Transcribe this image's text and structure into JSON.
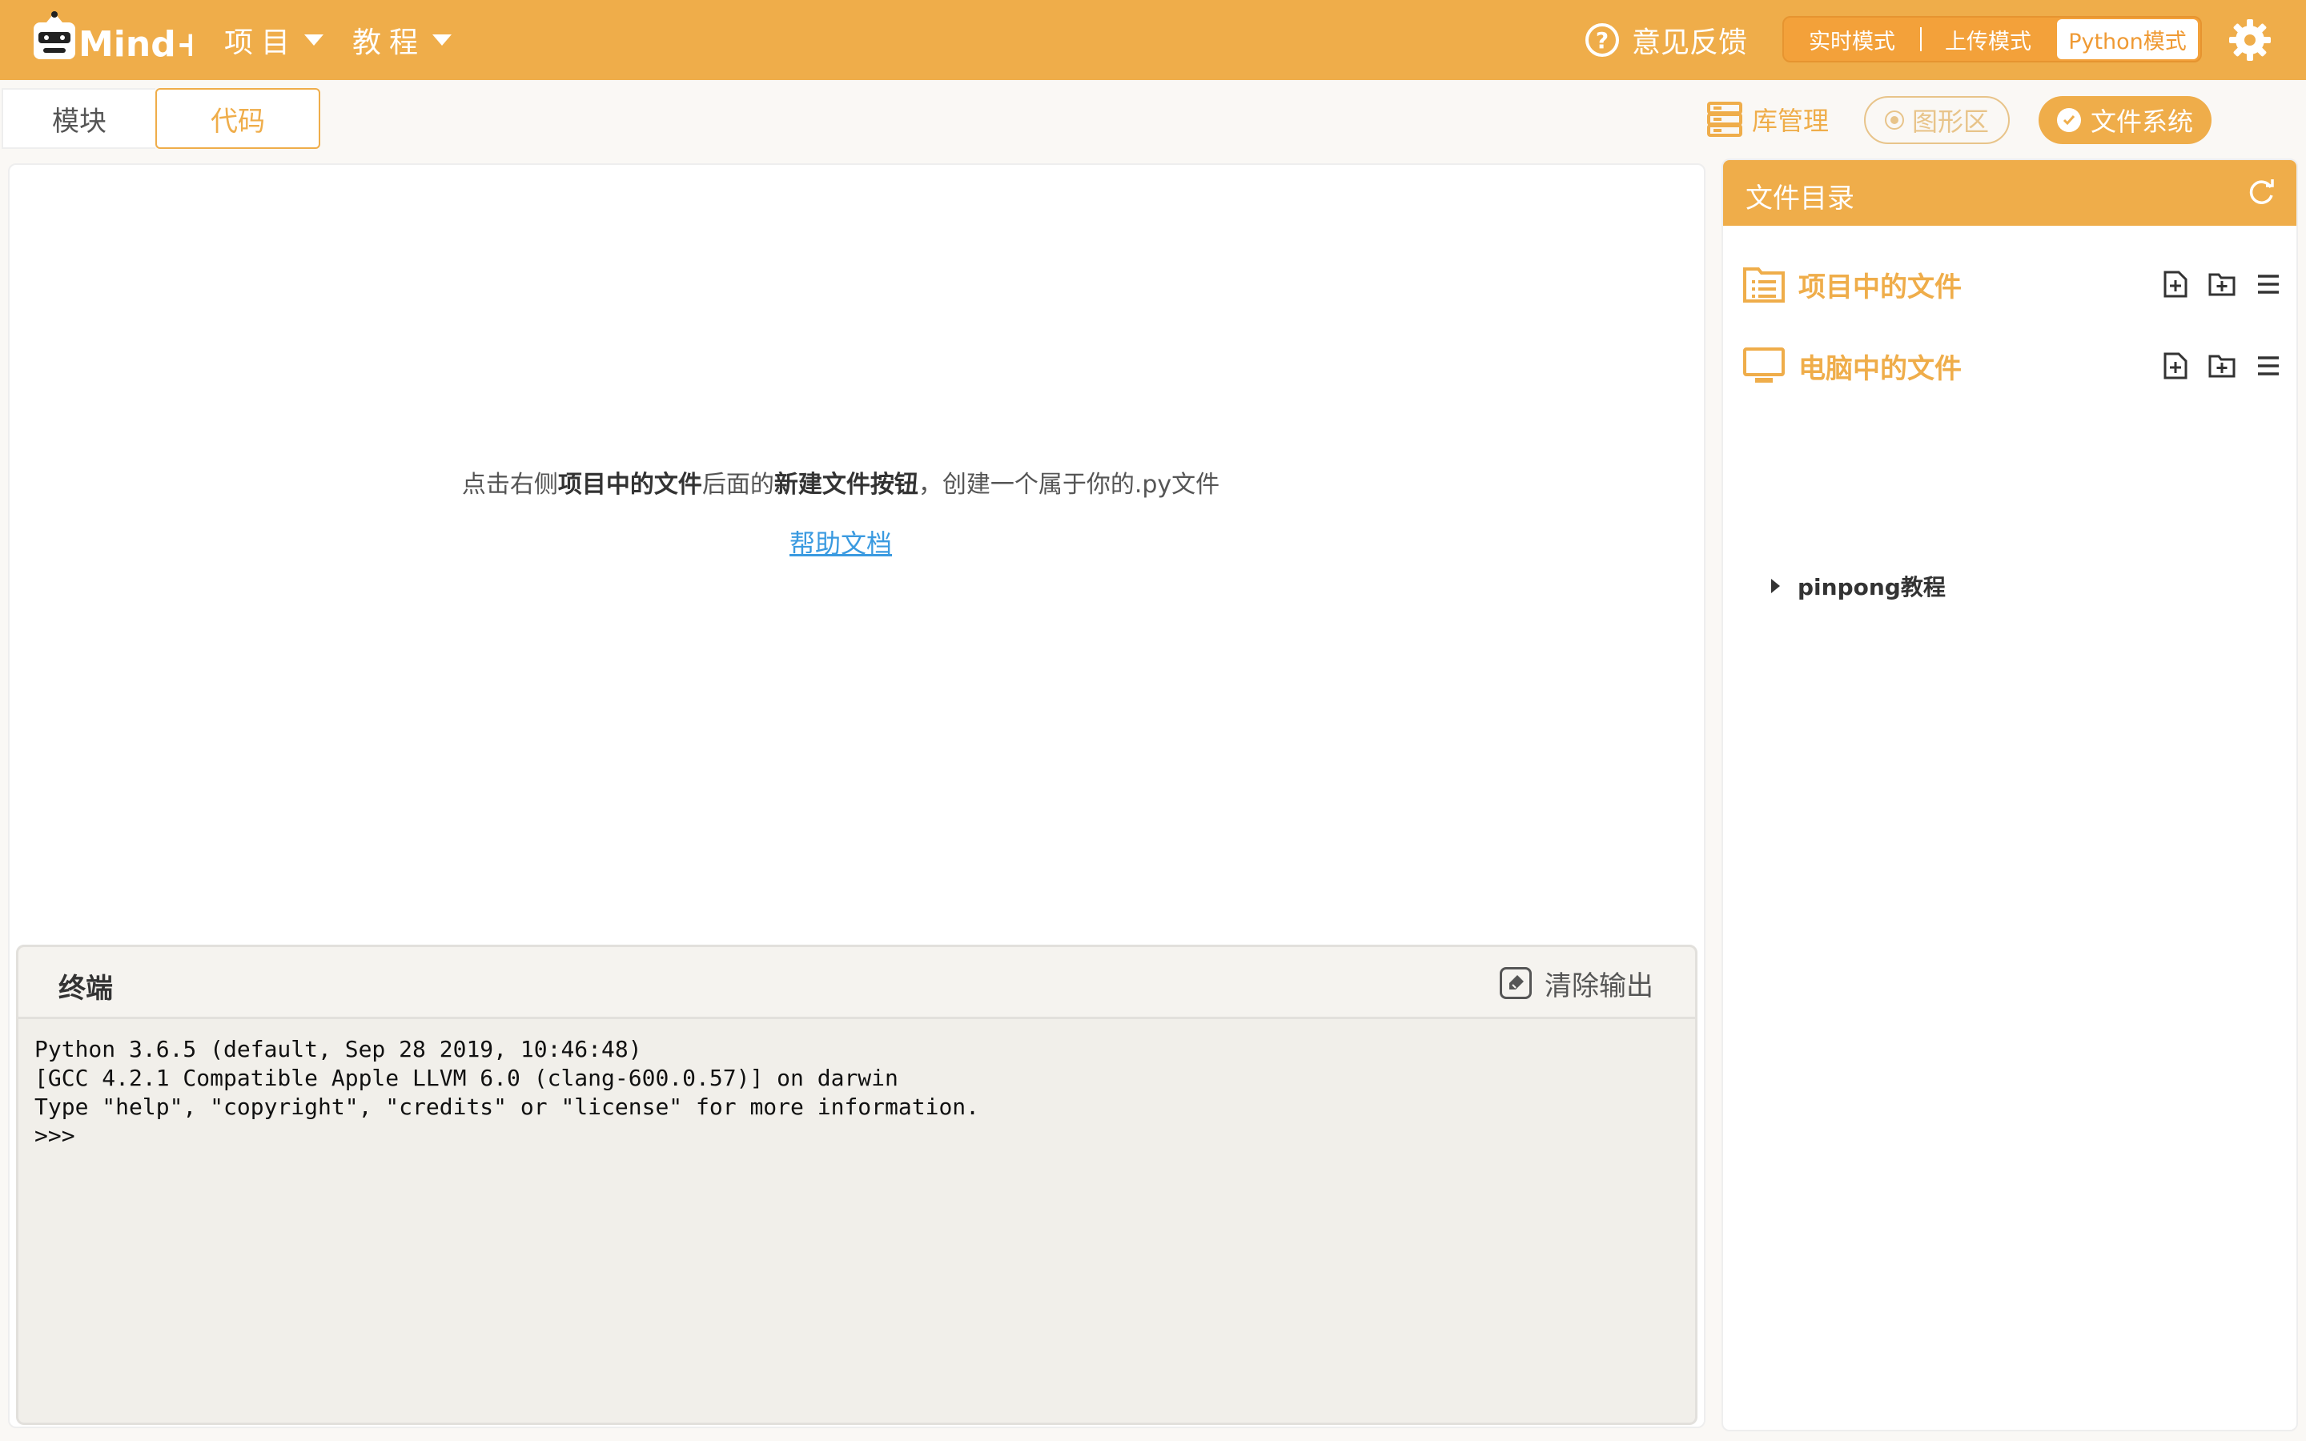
{
  "app": {
    "logo_text": "Mind+"
  },
  "menu": {
    "project": "项目",
    "tutorial": "教程"
  },
  "header": {
    "feedback": "意见反馈",
    "modes": [
      "实时模式",
      "上传模式",
      "Python模式"
    ],
    "active_mode": "Python模式"
  },
  "tabs": {
    "blocks": "模块",
    "code": "代码"
  },
  "toolbar": {
    "library": "库管理",
    "graphic": "图形区",
    "filesystem": "文件系统"
  },
  "editor": {
    "hint_prefix": "点击右侧",
    "hint_bold1": "项目中的文件",
    "hint_mid": "后面的",
    "hint_bold2": "新建文件按钮",
    "hint_suffix": "，创建一个属于你的.py文件",
    "help_link": "帮助文档"
  },
  "terminal": {
    "title": "终端",
    "clear": "清除输出",
    "output": "Python 3.6.5 (default, Sep 28 2019, 10:46:48)\n[GCC 4.2.1 Compatible Apple LLVM 6.0 (clang-600.0.57)] on darwin\nType \"help\", \"copyright\", \"credits\" or \"license\" for more information.\n>>>"
  },
  "file_panel": {
    "title": "文件目录",
    "project_files": "项目中的文件",
    "computer_files": "电脑中的文件",
    "tree": [
      "pinpong教程"
    ]
  },
  "colors": {
    "accent": "#efad4a",
    "link": "#3a9ae0",
    "terminal_bg": "#f1efea"
  }
}
